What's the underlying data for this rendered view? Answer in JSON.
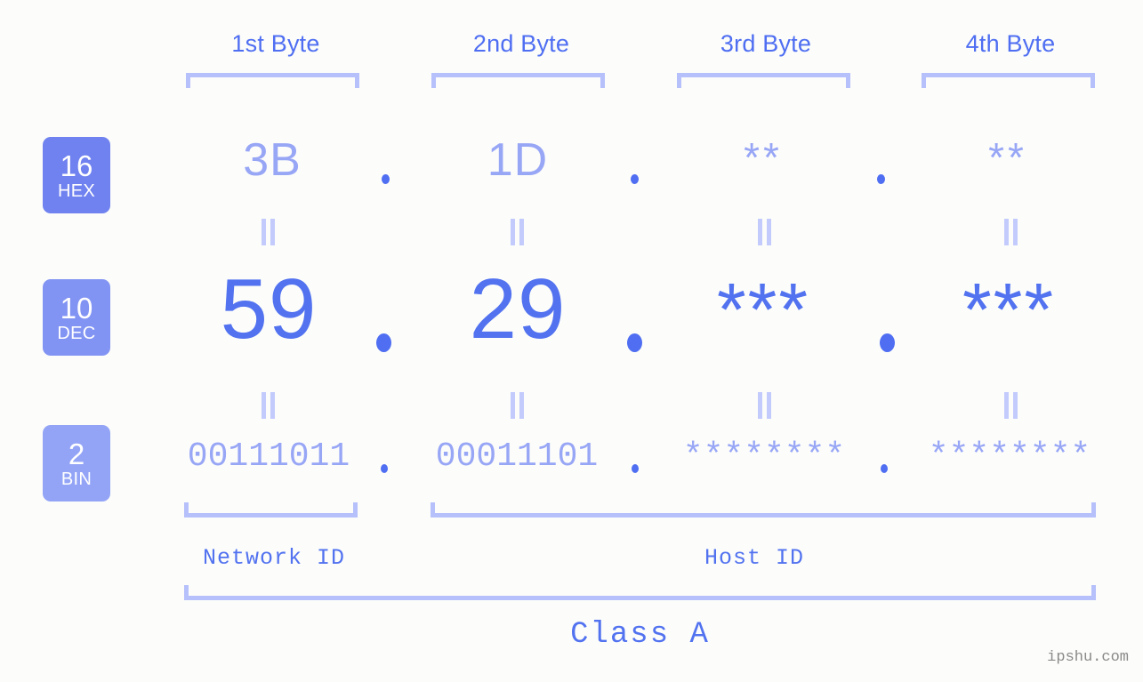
{
  "meta": {
    "background_color": "#fcfdfa",
    "accent_strong": "#4f6ef2",
    "accent_mid": "#5272f0",
    "accent_light": "#98a6f6",
    "accent_bracket": "#b6c0fb",
    "equals_color": "#c3cbfc"
  },
  "headers": {
    "byte_labels": [
      "1st Byte",
      "2nd Byte",
      "3rd Byte",
      "4th Byte"
    ]
  },
  "bases": [
    {
      "number": "16",
      "name": "HEX",
      "badge_color": "#7082ef"
    },
    {
      "number": "10",
      "name": "DEC",
      "badge_color": "#8294f3"
    },
    {
      "number": "2",
      "name": "BIN",
      "badge_color": "#93a4f6"
    }
  ],
  "rows": {
    "hex": {
      "base_number": "16",
      "base_name": "HEX",
      "values": [
        "3B",
        "1D",
        "**",
        "**"
      ],
      "separator": "."
    },
    "dec": {
      "base_number": "10",
      "base_name": "DEC",
      "values": [
        "59",
        "29",
        "***",
        "***"
      ],
      "separator": "."
    },
    "bin": {
      "base_number": "2",
      "base_name": "BIN",
      "values": [
        "00111011",
        "00011101",
        "********",
        "********"
      ],
      "separator": "."
    }
  },
  "equals_symbol": "=",
  "footer": {
    "network_id_label": "Network ID",
    "host_id_label": "Host ID",
    "class_label": "Class A"
  },
  "watermark": "ipshu.com"
}
